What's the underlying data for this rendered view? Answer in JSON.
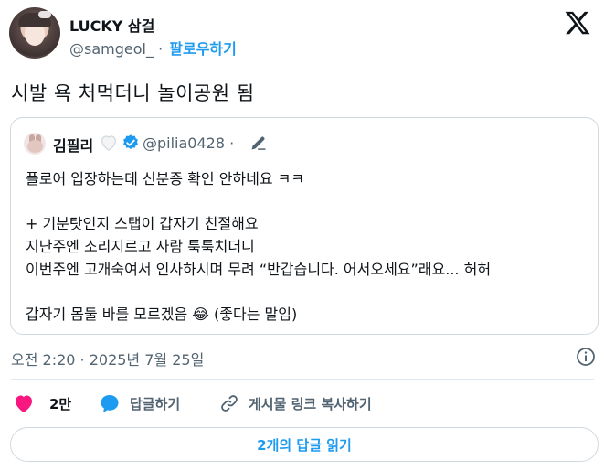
{
  "author": {
    "name": "LUCKY 삼걸",
    "handle": "@samgeol_",
    "separator": "·",
    "follow_label": "팔로우하기"
  },
  "tweet_text": "시발 욕 처먹더니 놀이공원 됨",
  "quote": {
    "name": "김필리",
    "handle": "@pilia0428",
    "separator": "·",
    "lines": [
      "플로어 입장하는데 신분증 확인 안하네요 ㅋㅋ",
      "+ 기분탓인지 스탭이 갑자기 친절해요",
      "지난주엔 소리지르고 사람 툭툭치더니",
      "이번주엔 고개숙여서 인사하시며 무려 “반갑습니다. 어서오세요”래요... 허허",
      "갑자기 몸둘 바를 모르겠음 😂 (좋다는 말임)"
    ]
  },
  "timestamp": "오전 2:20 · 2025년 7월 25일",
  "actions": {
    "like_count": "2만",
    "reply_label": "답글하기",
    "copy_link_label": "게시물 링크 복사하기"
  },
  "read_replies_label": "2개의 답글 읽기",
  "colors": {
    "accent": "#1d9bf0",
    "like": "#f91880",
    "text": "#0f1419",
    "muted": "#536471",
    "border": "#cfd9de"
  },
  "icons": [
    "x-logo-icon",
    "white-heart-icon",
    "verified-badge-icon",
    "pencil-icon",
    "info-icon",
    "heart-icon",
    "reply-bubble-icon",
    "link-icon"
  ]
}
